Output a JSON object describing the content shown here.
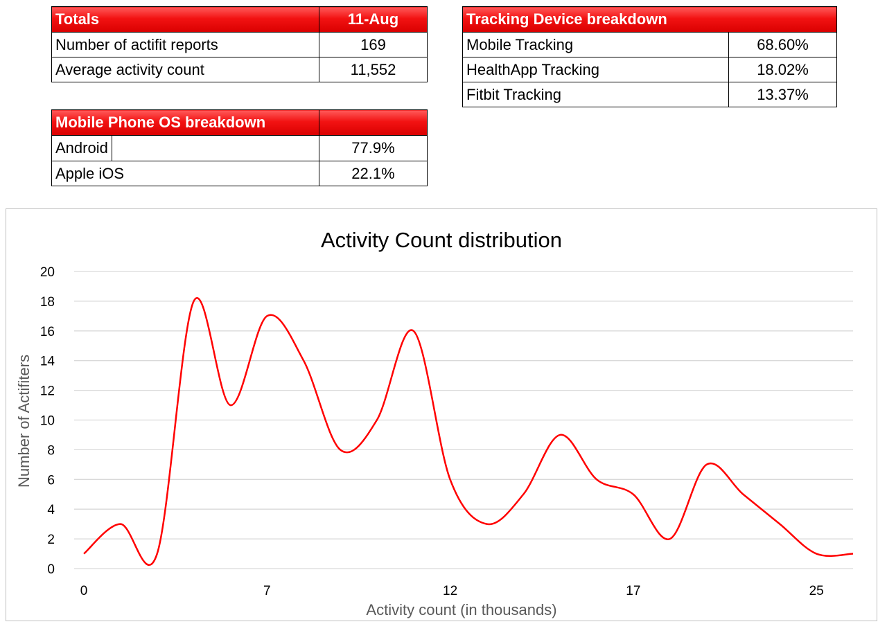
{
  "totals": {
    "header_label": "Totals",
    "header_date": "11-Aug",
    "rows": [
      {
        "label": "Number of actifit reports",
        "value": "169"
      },
      {
        "label": "Average activity count",
        "value": "11,552"
      }
    ]
  },
  "tracking": {
    "header_label": "Tracking Device breakdown",
    "rows": [
      {
        "label": "Mobile Tracking",
        "value": "68.60%"
      },
      {
        "label": "HealthApp Tracking",
        "value": "18.02%"
      },
      {
        "label": "Fitbit Tracking",
        "value": "13.37%"
      }
    ]
  },
  "os": {
    "header_label": "Mobile Phone OS breakdown",
    "rows": [
      {
        "label": "Android",
        "value": "77.9%"
      },
      {
        "label": "Apple iOS",
        "value": "22.1%"
      }
    ]
  },
  "colors": {
    "header_red": "#e00000",
    "line": "#ff0000",
    "grid": "#d9d9d9",
    "axis_text": "#595959"
  },
  "chart_data": {
    "type": "line",
    "title": "Activity Count distribution",
    "xlabel": "Activity count (in thousands)",
    "ylabel": "Number of Actifiters",
    "ylim": [
      0,
      20
    ],
    "yticks": [
      0,
      2,
      4,
      6,
      8,
      10,
      12,
      14,
      16,
      18,
      20
    ],
    "grid": true,
    "smooth": true,
    "x_tick_labels": [
      "0",
      "7",
      "12",
      "17",
      "25"
    ],
    "x_tick_positions": [
      0,
      5,
      10,
      15,
      20
    ],
    "series": [
      {
        "values": [
          1,
          3,
          1,
          18,
          11,
          17,
          14,
          8,
          10,
          16,
          6,
          3,
          5,
          9,
          6,
          5,
          2,
          7,
          5,
          3,
          1,
          1
        ]
      }
    ]
  }
}
